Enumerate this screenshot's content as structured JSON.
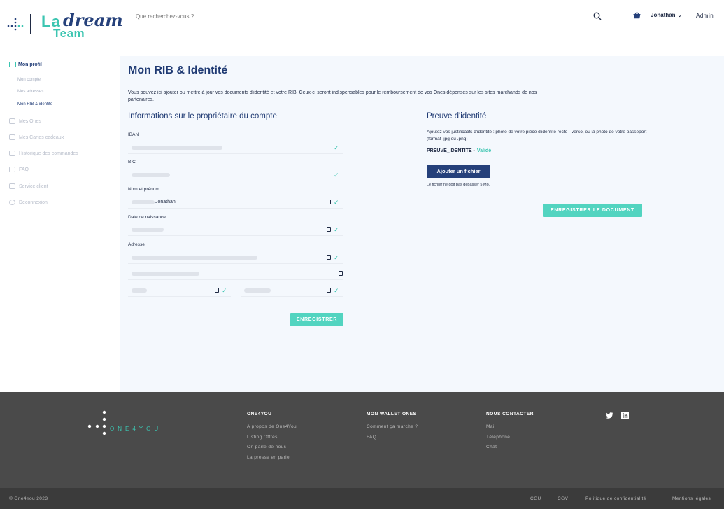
{
  "header": {
    "logo_la": "La",
    "logo_dream": "dream",
    "logo_team": "Team",
    "search_placeholder": "Que recherchez-vous ?",
    "user_name": "Jonathan",
    "admin_label": "Admin"
  },
  "sidebar": {
    "heading": "Mon profil",
    "sub_items": [
      "Mon compte",
      "Mes adresses",
      "Mon RIB & identite"
    ],
    "items": [
      "Mes Ones",
      "Mes Cartes cadeaux",
      "Historique des commandes",
      "FAQ",
      "Service client",
      "Deconnexion"
    ]
  },
  "main": {
    "title": "Mon RIB & Identité",
    "intro": "Vous pouvez ici ajouter ou mettre à jour vos documents d'identité et votre RIB. Ceux-ci seront indispensables pour le remboursement de vos Ones dépensés sur les sites marchands de nos partenaires.",
    "owner_title": "Informations sur le propriétaire du compte",
    "labels": {
      "iban": "IBAN",
      "bic": "BIC",
      "name": "Nom et prénom",
      "birth": "Date de naissance",
      "address": "Adresse"
    },
    "name_value": "Jonathan",
    "save_button": "ENREGISTRER",
    "proof": {
      "title": "Preuve d'identité",
      "description": "Ajoutez vos justificatifs d'identité : photo de votre pièce d'identité recto - verso, ou la photo de votre passeport (format .jpg ou .png)",
      "doc_name": "PREUVE_IDENTITE -",
      "status": "Validé",
      "add_file_button": "Ajouter un fichier",
      "file_note": "Le fichier ne doit pas dépasser 5 Mo.",
      "save_doc_button": "ENREGISTRER LE DOCUMENT"
    }
  },
  "footer": {
    "logo_text": "ONE4YOU",
    "col1": {
      "title": "ONE4YOU",
      "links": [
        "A propos de One4You",
        "Listing Offres",
        "On parle de nous",
        "La presse en parle"
      ]
    },
    "col2": {
      "title": "MON WALLET ONES",
      "links": [
        "Comment ça marche ?",
        "FAQ"
      ]
    },
    "col3": {
      "title": "NOUS CONTACTER",
      "links": [
        "Mail",
        "Téléphone",
        "Chat"
      ]
    },
    "copyright": "© One4You 2023",
    "legal": [
      "CGU",
      "CGV",
      "Politique de confidentialité",
      "Mentions légales"
    ]
  },
  "colors": {
    "accent": "#52d4c0",
    "primary": "#25407a",
    "footer": "#4a4a4a"
  }
}
